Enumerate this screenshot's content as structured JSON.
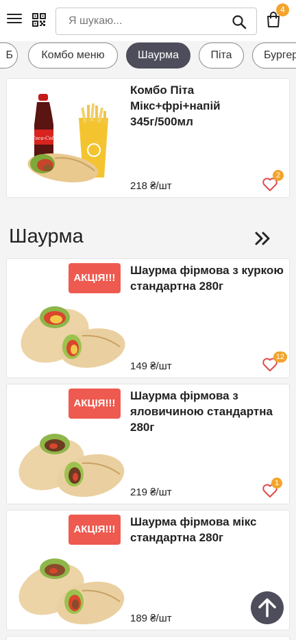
{
  "header": {
    "search_placeholder": "Я шукаю...",
    "cart_count": "4"
  },
  "categories": [
    "Б",
    "Комбо меню",
    "Шаурма",
    "Піта",
    "Бургери"
  ],
  "active_category": "Шаурма",
  "combo_product": {
    "title": "Комбо Піта Мікс+фрі+напій 345г/500мл",
    "price": "218 ₴/шт",
    "fav_count": "2"
  },
  "section": {
    "title": "Шаурма"
  },
  "products": [
    {
      "promo": "АКЦІЯ!!!",
      "title": "Шаурма фірмова з куркою стандартна 280г",
      "price": "149 ₴/шт",
      "fav_count": "12"
    },
    {
      "promo": "АКЦІЯ!!!",
      "title": "Шаурма фірмова з яловичиною стандартна 280г",
      "price": "219 ₴/шт",
      "fav_count": "1"
    },
    {
      "promo": "АКЦІЯ!!!",
      "title": "Шаурма фірмова мікс стандартна 280г",
      "price": "189 ₴/шт",
      "fav_count": ""
    }
  ],
  "colors": {
    "accent": "#f2a42c",
    "promo": "#ee5a4f",
    "active_chip": "#4e4d5b",
    "favorite": "#e04a4a"
  }
}
